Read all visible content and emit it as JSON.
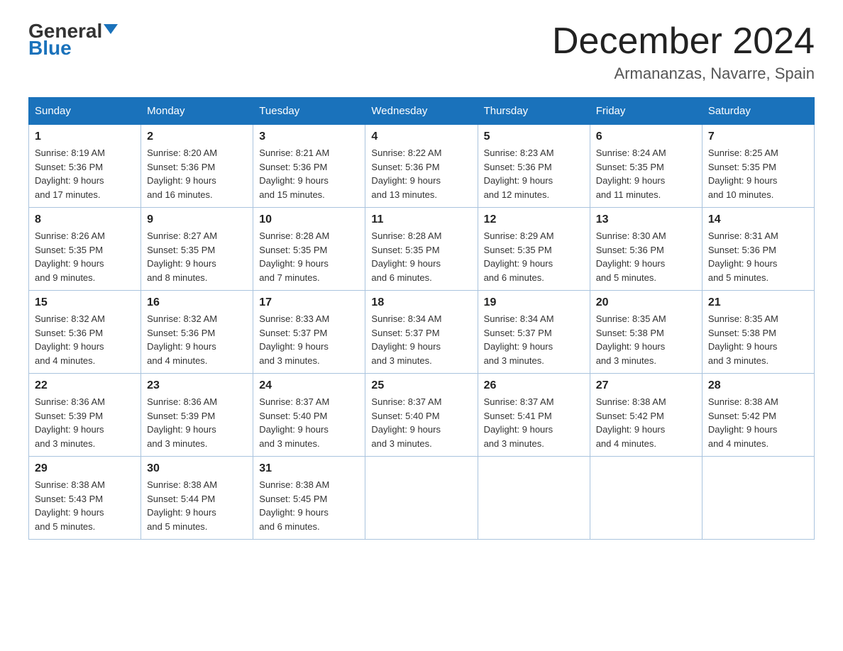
{
  "logo": {
    "general": "General",
    "blue": "Blue"
  },
  "title": "December 2024",
  "location": "Armananzas, Navarre, Spain",
  "days_of_week": [
    "Sunday",
    "Monday",
    "Tuesday",
    "Wednesday",
    "Thursday",
    "Friday",
    "Saturday"
  ],
  "weeks": [
    [
      {
        "day": "1",
        "sunrise": "8:19 AM",
        "sunset": "5:36 PM",
        "daylight": "9 hours and 17 minutes."
      },
      {
        "day": "2",
        "sunrise": "8:20 AM",
        "sunset": "5:36 PM",
        "daylight": "9 hours and 16 minutes."
      },
      {
        "day": "3",
        "sunrise": "8:21 AM",
        "sunset": "5:36 PM",
        "daylight": "9 hours and 15 minutes."
      },
      {
        "day": "4",
        "sunrise": "8:22 AM",
        "sunset": "5:36 PM",
        "daylight": "9 hours and 13 minutes."
      },
      {
        "day": "5",
        "sunrise": "8:23 AM",
        "sunset": "5:36 PM",
        "daylight": "9 hours and 12 minutes."
      },
      {
        "day": "6",
        "sunrise": "8:24 AM",
        "sunset": "5:35 PM",
        "daylight": "9 hours and 11 minutes."
      },
      {
        "day": "7",
        "sunrise": "8:25 AM",
        "sunset": "5:35 PM",
        "daylight": "9 hours and 10 minutes."
      }
    ],
    [
      {
        "day": "8",
        "sunrise": "8:26 AM",
        "sunset": "5:35 PM",
        "daylight": "9 hours and 9 minutes."
      },
      {
        "day": "9",
        "sunrise": "8:27 AM",
        "sunset": "5:35 PM",
        "daylight": "9 hours and 8 minutes."
      },
      {
        "day": "10",
        "sunrise": "8:28 AM",
        "sunset": "5:35 PM",
        "daylight": "9 hours and 7 minutes."
      },
      {
        "day": "11",
        "sunrise": "8:28 AM",
        "sunset": "5:35 PM",
        "daylight": "9 hours and 6 minutes."
      },
      {
        "day": "12",
        "sunrise": "8:29 AM",
        "sunset": "5:35 PM",
        "daylight": "9 hours and 6 minutes."
      },
      {
        "day": "13",
        "sunrise": "8:30 AM",
        "sunset": "5:36 PM",
        "daylight": "9 hours and 5 minutes."
      },
      {
        "day": "14",
        "sunrise": "8:31 AM",
        "sunset": "5:36 PM",
        "daylight": "9 hours and 5 minutes."
      }
    ],
    [
      {
        "day": "15",
        "sunrise": "8:32 AM",
        "sunset": "5:36 PM",
        "daylight": "9 hours and 4 minutes."
      },
      {
        "day": "16",
        "sunrise": "8:32 AM",
        "sunset": "5:36 PM",
        "daylight": "9 hours and 4 minutes."
      },
      {
        "day": "17",
        "sunrise": "8:33 AM",
        "sunset": "5:37 PM",
        "daylight": "9 hours and 3 minutes."
      },
      {
        "day": "18",
        "sunrise": "8:34 AM",
        "sunset": "5:37 PM",
        "daylight": "9 hours and 3 minutes."
      },
      {
        "day": "19",
        "sunrise": "8:34 AM",
        "sunset": "5:37 PM",
        "daylight": "9 hours and 3 minutes."
      },
      {
        "day": "20",
        "sunrise": "8:35 AM",
        "sunset": "5:38 PM",
        "daylight": "9 hours and 3 minutes."
      },
      {
        "day": "21",
        "sunrise": "8:35 AM",
        "sunset": "5:38 PM",
        "daylight": "9 hours and 3 minutes."
      }
    ],
    [
      {
        "day": "22",
        "sunrise": "8:36 AM",
        "sunset": "5:39 PM",
        "daylight": "9 hours and 3 minutes."
      },
      {
        "day": "23",
        "sunrise": "8:36 AM",
        "sunset": "5:39 PM",
        "daylight": "9 hours and 3 minutes."
      },
      {
        "day": "24",
        "sunrise": "8:37 AM",
        "sunset": "5:40 PM",
        "daylight": "9 hours and 3 minutes."
      },
      {
        "day": "25",
        "sunrise": "8:37 AM",
        "sunset": "5:40 PM",
        "daylight": "9 hours and 3 minutes."
      },
      {
        "day": "26",
        "sunrise": "8:37 AM",
        "sunset": "5:41 PM",
        "daylight": "9 hours and 3 minutes."
      },
      {
        "day": "27",
        "sunrise": "8:38 AM",
        "sunset": "5:42 PM",
        "daylight": "9 hours and 4 minutes."
      },
      {
        "day": "28",
        "sunrise": "8:38 AM",
        "sunset": "5:42 PM",
        "daylight": "9 hours and 4 minutes."
      }
    ],
    [
      {
        "day": "29",
        "sunrise": "8:38 AM",
        "sunset": "5:43 PM",
        "daylight": "9 hours and 5 minutes."
      },
      {
        "day": "30",
        "sunrise": "8:38 AM",
        "sunset": "5:44 PM",
        "daylight": "9 hours and 5 minutes."
      },
      {
        "day": "31",
        "sunrise": "8:38 AM",
        "sunset": "5:45 PM",
        "daylight": "9 hours and 6 minutes."
      },
      null,
      null,
      null,
      null
    ]
  ],
  "labels": {
    "sunrise": "Sunrise:",
    "sunset": "Sunset:",
    "daylight": "Daylight:"
  }
}
